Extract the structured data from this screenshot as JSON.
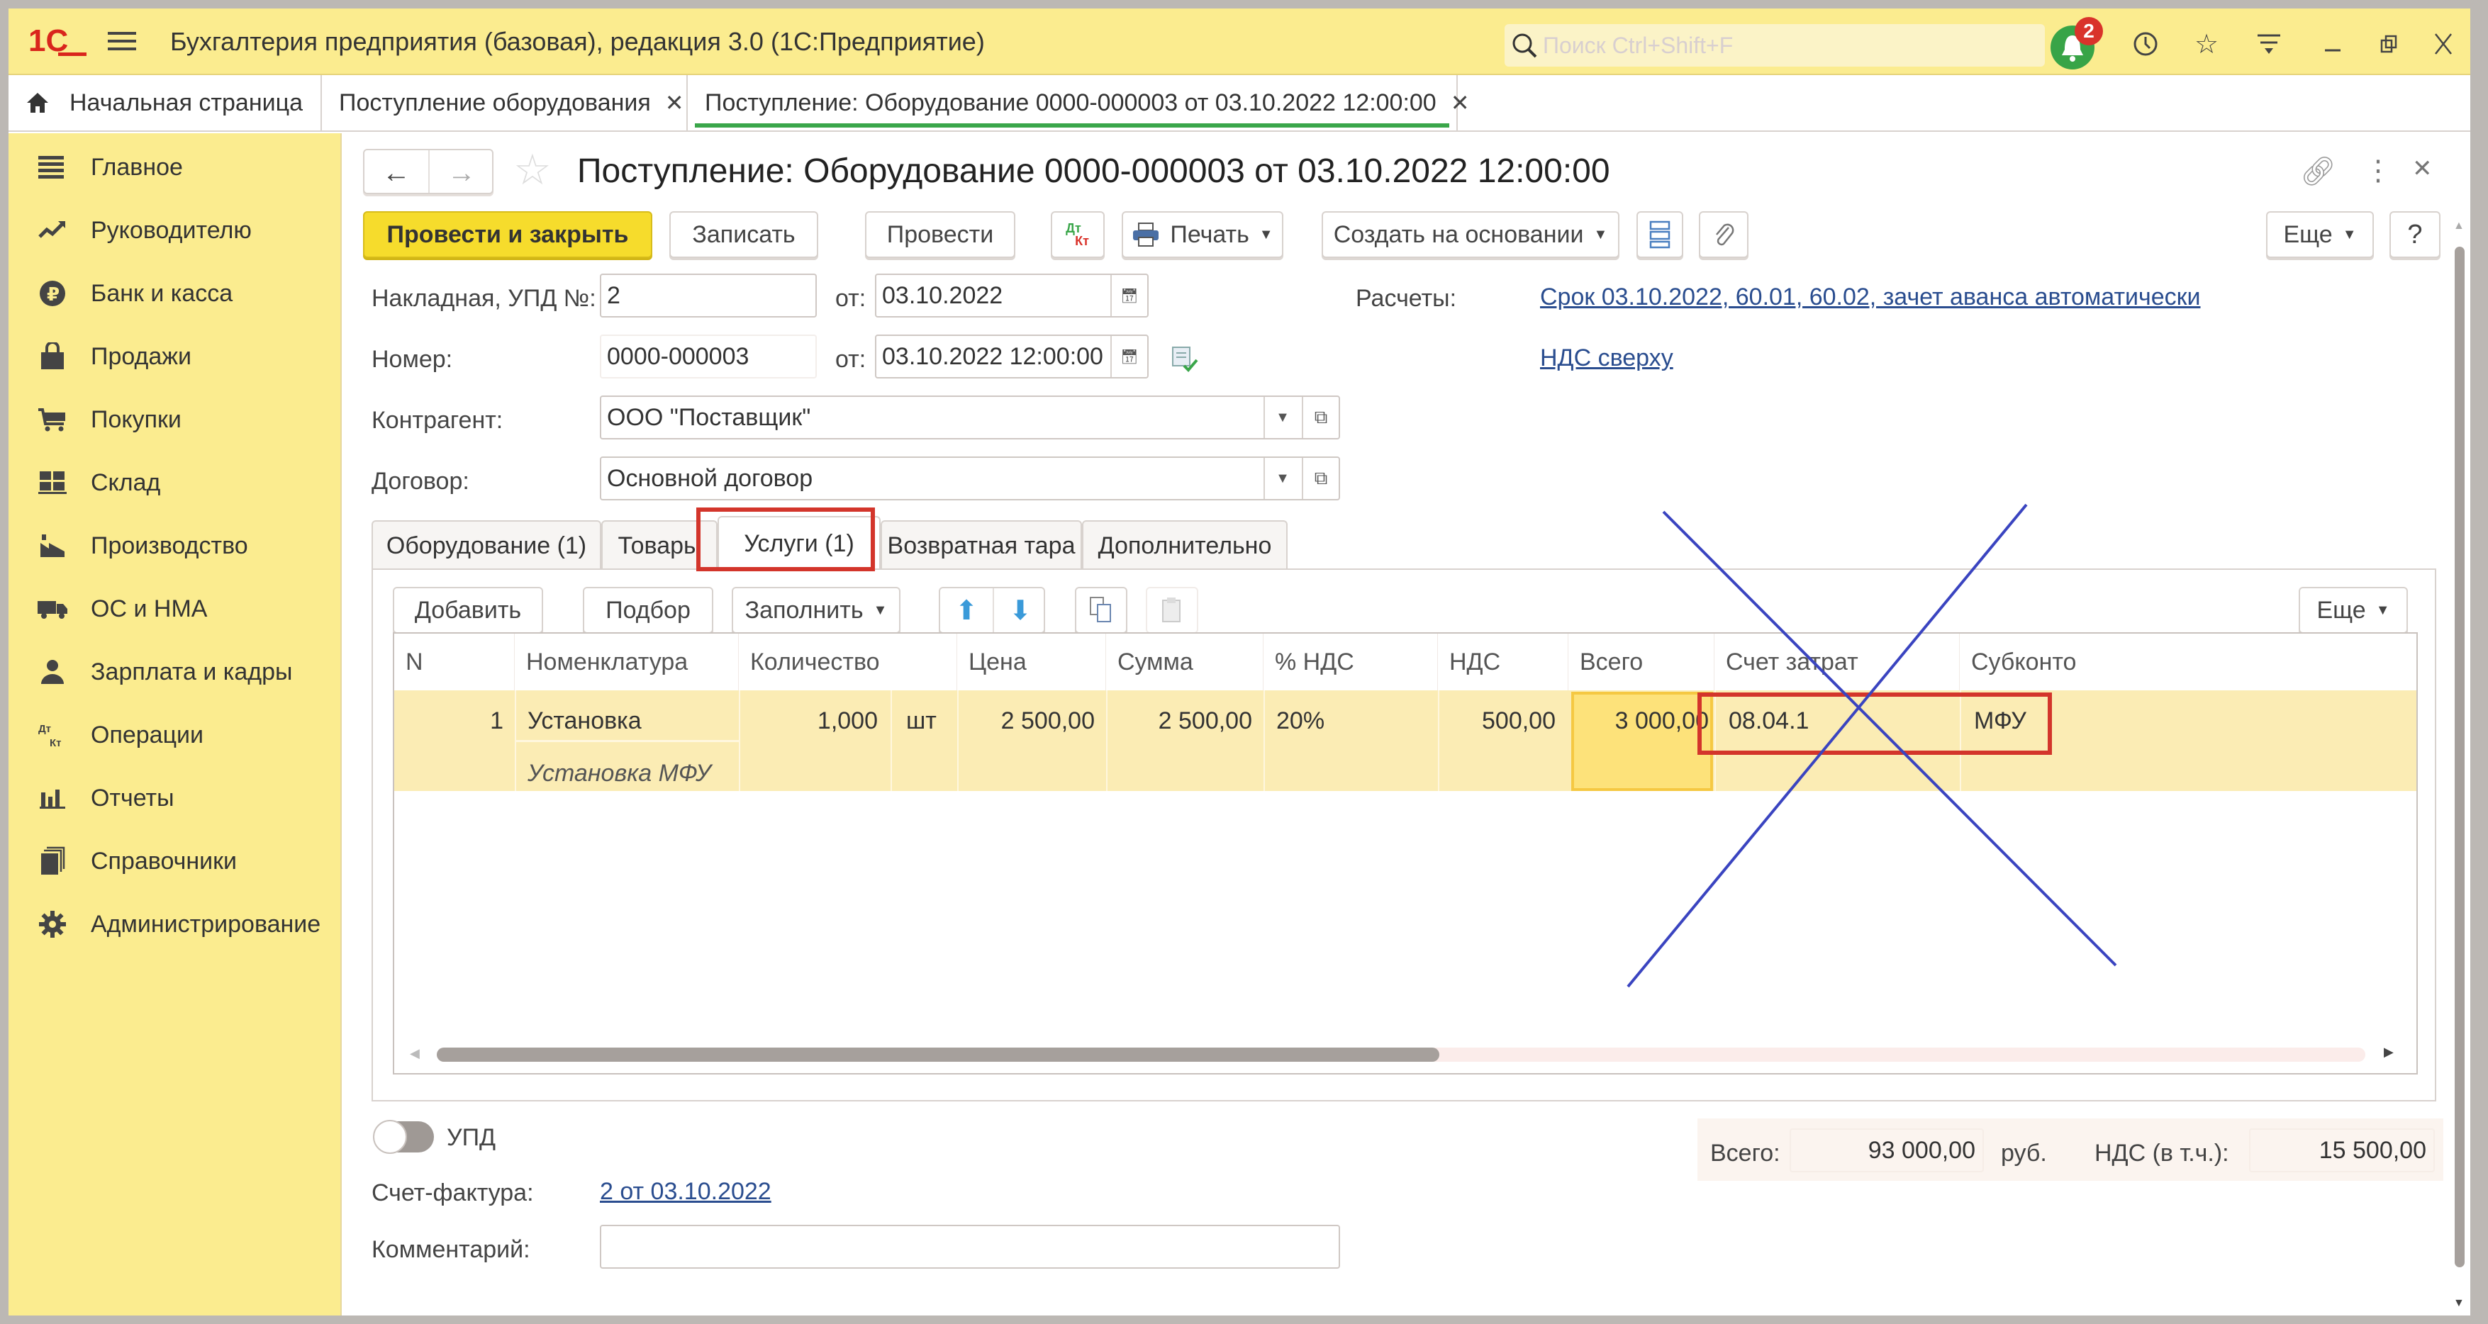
{
  "titlebar": {
    "app_title": "Бухгалтерия предприятия (базовая), редакция 3.0  (1С:Предприятие)",
    "search_placeholder": "Поиск Ctrl+Shift+F",
    "notifications_count": "2"
  },
  "tabs": [
    {
      "label": "Начальная страница",
      "closable": false
    },
    {
      "label": "Поступление оборудования",
      "closable": true
    },
    {
      "label": "Поступление: Оборудование 0000-000003 от 03.10.2022 12:00:00",
      "closable": true,
      "active": true
    }
  ],
  "sidebar": {
    "items": [
      {
        "label": "Главное",
        "icon": "menu-lines-icon"
      },
      {
        "label": "Руководителю",
        "icon": "trend-icon"
      },
      {
        "label": "Банк и касса",
        "icon": "ruble-icon"
      },
      {
        "label": "Продажи",
        "icon": "bag-icon"
      },
      {
        "label": "Покупки",
        "icon": "cart-icon"
      },
      {
        "label": "Склад",
        "icon": "warehouse-icon"
      },
      {
        "label": "Производство",
        "icon": "factory-icon"
      },
      {
        "label": "ОС и НМА",
        "icon": "truck-icon"
      },
      {
        "label": "Зарплата и кадры",
        "icon": "person-icon"
      },
      {
        "label": "Операции",
        "icon": "dt-kt-icon"
      },
      {
        "label": "Отчеты",
        "icon": "bar-chart-icon"
      },
      {
        "label": "Справочники",
        "icon": "books-icon"
      },
      {
        "label": "Администрирование",
        "icon": "gear-icon"
      }
    ]
  },
  "document": {
    "title": "Поступление: Оборудование 0000-000003 от 03.10.2022 12:00:00",
    "toolbar": {
      "post_close": "Провести и закрыть",
      "save": "Записать",
      "post": "Провести",
      "dtkt_top": "Дт",
      "dtkt_bottom": "Кт",
      "print": "Печать",
      "create_based": "Создать на основании",
      "more": "Еще",
      "help": "?"
    },
    "fields": {
      "invoice_label": "Накладная, УПД №:",
      "invoice_value": "2",
      "from_label": "от:",
      "invoice_date": "03.10.2022",
      "number_label": "Номер:",
      "number_value": "0000-000003",
      "doc_datetime": "03.10.2022 12:00:00",
      "counterparty_label": "Контрагент:",
      "counterparty_value": "ООО \"Поставщик\"",
      "contract_label": "Договор:",
      "contract_value": "Основной договор",
      "settlements_label": "Расчеты:",
      "settlements_link": "Срок 03.10.2022, 60.01, 60.02, зачет аванса автоматически",
      "vat_link": "НДС сверху"
    },
    "form_tabs": [
      {
        "label": "Оборудование (1)"
      },
      {
        "label": "Товары"
      },
      {
        "label": "Услуги (1)",
        "active": true
      },
      {
        "label": "Возвратная тара"
      },
      {
        "label": "Дополнительно"
      }
    ],
    "table_toolbar": {
      "add": "Добавить",
      "pick": "Подбор",
      "fill": "Заполнить",
      "more": "Еще"
    },
    "table": {
      "columns": [
        "N",
        "Номенклатура",
        "Количество",
        "Цена",
        "Сумма",
        "% НДС",
        "НДС",
        "Всего",
        "Счет затрат",
        "Субконто"
      ],
      "rows": [
        {
          "n": "1",
          "item": "Установка",
          "item_content": "Установка МФУ",
          "qty": "1,000",
          "unit": "шт",
          "price": "2 500,00",
          "sum": "2 500,00",
          "vat_rate": "20%",
          "vat": "500,00",
          "total": "3 000,00",
          "account": "08.04.1",
          "subconto": "МФУ"
        }
      ],
      "hscroll_position": 0.0,
      "hscroll_visible_fraction": 0.52
    },
    "footer": {
      "upd_label": "УПД",
      "upd_on": false,
      "invoice_label": "Счет-фактура:",
      "invoice_link": "2 от 03.10.2022",
      "comment_label": "Комментарий:",
      "comment_value": "",
      "total_label": "Всего:",
      "total_value": "93 000,00",
      "currency": "руб.",
      "vat_incl_label": "НДС (в т.ч.):",
      "vat_incl_value": "15 500,00"
    }
  },
  "annotations": {
    "highlight_color": "#d3352b",
    "cross_color": "#3a44c0"
  }
}
